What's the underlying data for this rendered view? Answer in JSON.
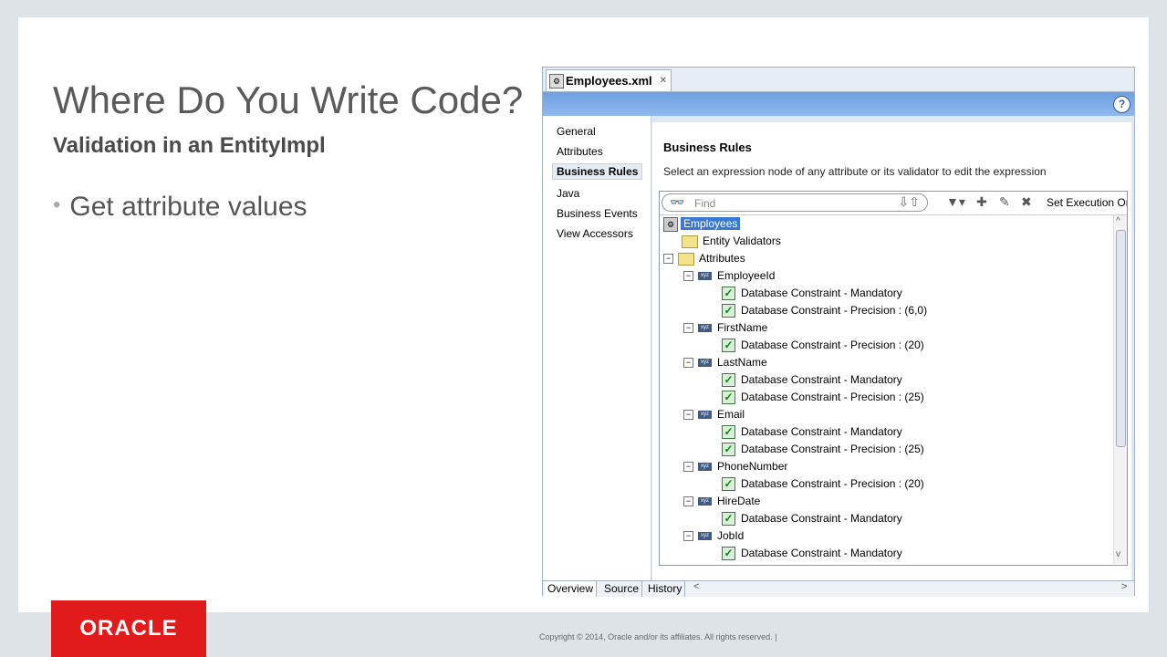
{
  "slide": {
    "title": "Where Do You Write Code?",
    "subtitle": "Validation in an EntityImpl",
    "bullet": "Get attribute values",
    "logo": "ORACLE",
    "copyright": "Copyright © 2014, Oracle and/or its affiliates. All rights reserved.  |"
  },
  "ide": {
    "file_tab": "Employees.xml",
    "nav_items": [
      "General",
      "Attributes",
      "Business Rules",
      "Java",
      "Business Events",
      "View Accessors"
    ],
    "selected_nav": "Business Rules",
    "section_title": "Business Rules",
    "section_desc": "Select an expression node of any attribute or its validator to edit the expression",
    "find_placeholder": "Find",
    "set_execution": "Set Execution Or",
    "tree": {
      "root": "Employees",
      "entity_validators": "Entity Validators",
      "attributes_label": "Attributes",
      "attributes": [
        {
          "name": "EmployeeId",
          "rules": [
            "Database Constraint - Mandatory",
            "Database Constraint - Precision : (6,0)"
          ]
        },
        {
          "name": "FirstName",
          "rules": [
            "Database Constraint - Precision : (20)"
          ]
        },
        {
          "name": "LastName",
          "rules": [
            "Database Constraint - Mandatory",
            "Database Constraint - Precision : (25)"
          ]
        },
        {
          "name": "Email",
          "rules": [
            "Database Constraint - Mandatory",
            "Database Constraint - Precision : (25)"
          ]
        },
        {
          "name": "PhoneNumber",
          "rules": [
            "Database Constraint - Precision : (20)"
          ]
        },
        {
          "name": "HireDate",
          "rules": [
            "Database Constraint - Mandatory"
          ]
        },
        {
          "name": "JobId",
          "rules": [
            "Database Constraint - Mandatory"
          ]
        }
      ]
    },
    "bottom_tabs": [
      "Overview",
      "Source",
      "History"
    ],
    "colors": {
      "logo": "#e11b1b",
      "toolstrip": "#7aa8e6",
      "selection": "#3a78d6"
    }
  }
}
